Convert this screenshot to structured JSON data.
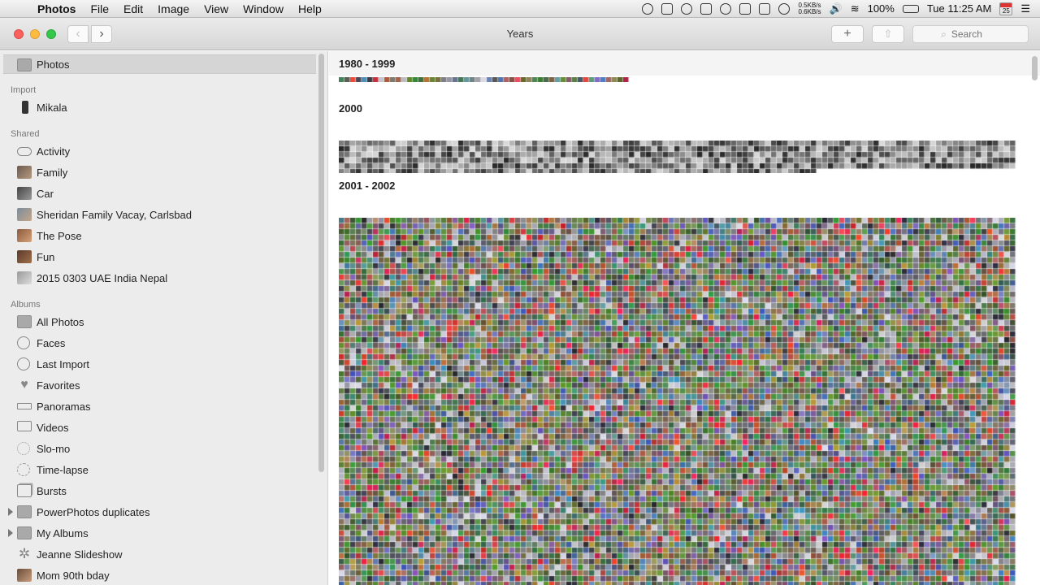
{
  "menubar": {
    "apple_icon": "apple-icon",
    "app_name": "Photos",
    "menus": [
      "File",
      "Edit",
      "Image",
      "View",
      "Window",
      "Help"
    ],
    "net_up": "0.5KB/s",
    "net_down": "0.6KB/s",
    "battery": "100%",
    "clock": "Tue 11:25 AM",
    "calendar_day": "25"
  },
  "window": {
    "title": "Years",
    "search_placeholder": "Search",
    "add_label": "+",
    "back_label": "‹",
    "forward_label": "›"
  },
  "sidebar": {
    "top": {
      "label": "Photos",
      "icon": "photos-icon"
    },
    "sections": [
      {
        "header": "Import",
        "items": [
          {
            "label": "Mikala",
            "icon": "iphone-icon"
          }
        ]
      },
      {
        "header": "Shared",
        "items": [
          {
            "label": "Activity",
            "icon": "cloud-icon"
          },
          {
            "label": "Family",
            "icon": "album-thumb-icon"
          },
          {
            "label": "Car",
            "icon": "album-thumb-icon"
          },
          {
            "label": "Sheridan Family Vacay, Carlsbad",
            "icon": "album-thumb-icon"
          },
          {
            "label": "The Pose",
            "icon": "album-thumb-icon"
          },
          {
            "label": "Fun",
            "icon": "album-thumb-icon"
          },
          {
            "label": "2015 0303 UAE India Nepal",
            "icon": "album-thumb-icon"
          }
        ]
      },
      {
        "header": "Albums",
        "items": [
          {
            "label": "All Photos",
            "icon": "all-photos-icon"
          },
          {
            "label": "Faces",
            "icon": "faces-icon"
          },
          {
            "label": "Last Import",
            "icon": "clock-icon"
          },
          {
            "label": "Favorites",
            "icon": "heart-icon"
          },
          {
            "label": "Panoramas",
            "icon": "panorama-icon"
          },
          {
            "label": "Videos",
            "icon": "video-icon"
          },
          {
            "label": "Slo-mo",
            "icon": "slomo-icon"
          },
          {
            "label": "Time-lapse",
            "icon": "timelapse-icon"
          },
          {
            "label": "Bursts",
            "icon": "bursts-icon"
          },
          {
            "label": "PowerPhotos duplicates",
            "icon": "folder-icon"
          },
          {
            "label": "My Albums",
            "icon": "folder-icon"
          },
          {
            "label": "Jeanne Slideshow",
            "icon": "slideshow-icon"
          },
          {
            "label": "Mom 90th bday",
            "icon": "album-thumb-icon"
          }
        ]
      }
    ]
  },
  "main": {
    "groups": [
      {
        "label": "1980 - 1999"
      },
      {
        "label": "2000"
      },
      {
        "label": "2001 - 2002"
      }
    ]
  }
}
